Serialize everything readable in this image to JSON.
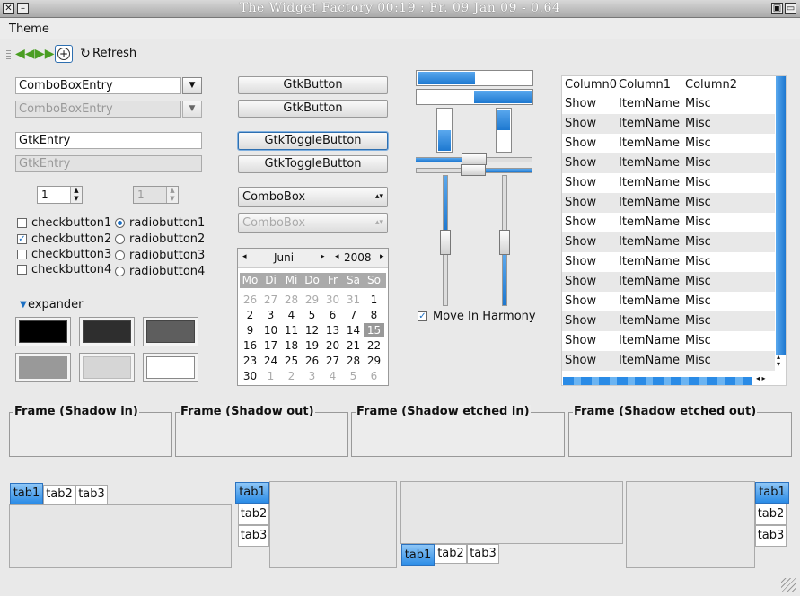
{
  "window": {
    "title": "The Widget Factory   00:19 : Fr. 09 Jan 09   -   0.64"
  },
  "menubar": {
    "theme": "Theme"
  },
  "toolbar": {
    "refresh": "Refresh"
  },
  "col1": {
    "combo_entry": "ComboBoxEntry",
    "combo_entry_disabled": "ComboBoxEntry",
    "entry": "GtkEntry",
    "entry_disabled": "GtkEntry",
    "spin": "1",
    "spin_disabled": "1",
    "checks": [
      "checkbutton1",
      "checkbutton2",
      "checkbutton3",
      "checkbutton4"
    ],
    "radios": [
      "radiobutton1",
      "radiobutton2",
      "radiobutton3",
      "radiobutton4"
    ],
    "expander": "expander"
  },
  "col2": {
    "button": "GtkButton",
    "button2": "GtkButton",
    "toggle": "GtkToggleButton",
    "toggle2": "GtkToggleButton",
    "combo": "ComboBox",
    "combo_disabled": "ComboBox"
  },
  "calendar": {
    "month": "Juni",
    "year": "2008",
    "weekdays": [
      "Mo",
      "Di",
      "Mi",
      "Do",
      "Fr",
      "Sa",
      "So"
    ],
    "rows": [
      [
        "26",
        "27",
        "28",
        "29",
        "30",
        "31",
        "1"
      ],
      [
        "2",
        "3",
        "4",
        "5",
        "6",
        "7",
        "8"
      ],
      [
        "9",
        "10",
        "11",
        "12",
        "13",
        "14",
        "15"
      ],
      [
        "16",
        "17",
        "18",
        "19",
        "20",
        "21",
        "22"
      ],
      [
        "23",
        "24",
        "25",
        "26",
        "27",
        "28",
        "29"
      ],
      [
        "30",
        "1",
        "2",
        "3",
        "4",
        "5",
        "6"
      ]
    ]
  },
  "scales": {
    "harmony": "Move In Harmony",
    "progress": [
      0.5,
      0.5
    ]
  },
  "tree": {
    "columns": [
      "Column0",
      "Column1",
      "Column2"
    ],
    "rows": [
      [
        "Show",
        "ItemName",
        "Misc"
      ],
      [
        "Show",
        "ItemName",
        "Misc"
      ],
      [
        "Show",
        "ItemName",
        "Misc"
      ],
      [
        "Show",
        "ItemName",
        "Misc"
      ],
      [
        "Show",
        "ItemName",
        "Misc"
      ],
      [
        "Show",
        "ItemName",
        "Misc"
      ],
      [
        "Show",
        "ItemName",
        "Misc"
      ],
      [
        "Show",
        "ItemName",
        "Misc"
      ],
      [
        "Show",
        "ItemName",
        "Misc"
      ],
      [
        "Show",
        "ItemName",
        "Misc"
      ],
      [
        "Show",
        "ItemName",
        "Misc"
      ],
      [
        "Show",
        "ItemName",
        "Misc"
      ],
      [
        "Show",
        "ItemName",
        "Misc"
      ],
      [
        "Show",
        "ItemName",
        "Misc"
      ]
    ]
  },
  "frames": [
    "Frame (Shadow in)",
    "Frame (Shadow out)",
    "Frame (Shadow etched in)",
    "Frame (Shadow etched out)"
  ],
  "tabs": [
    "tab1",
    "tab2",
    "tab3"
  ],
  "colors": {
    "accent": "#2a8be6",
    "swatches": [
      "#000000",
      "#2e2e2e",
      "#5e5e5e",
      "#999999",
      "#d6d6d6",
      "#ffffff"
    ]
  }
}
